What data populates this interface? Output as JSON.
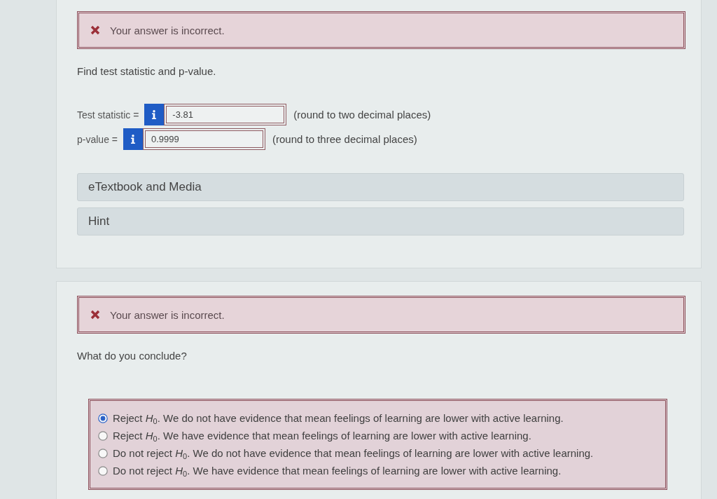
{
  "questions": [
    {
      "feedback": {
        "kind": "incorrect",
        "text": "Your answer is incorrect."
      },
      "prompt": "Find test statistic and p-value.",
      "fields": [
        {
          "label": "Test statistic =",
          "value": "-3.81",
          "note": "(round to two decimal places)"
        },
        {
          "label": "p-value =",
          "value": "0.9999",
          "note": "(round to three decimal places)"
        }
      ],
      "resources": [
        {
          "label": "eTextbook and Media"
        },
        {
          "label": "Hint"
        }
      ]
    },
    {
      "feedback": {
        "kind": "incorrect",
        "text": "Your answer is incorrect."
      },
      "prompt": "What do you conclude?",
      "options": [
        {
          "text": "Reject *H*$_{0}$. We do not have evidence that mean feelings of learning are lower with active learning.",
          "selected": true
        },
        {
          "text": "Reject *H*$_{0}$. We have evidence that mean feelings of learning are lower with active learning.",
          "selected": false
        },
        {
          "text": "Do not reject *H*$_{0}$. We do not have evidence that mean feelings of learning are lower with active learning.",
          "selected": false
        },
        {
          "text": "Do not reject *H*$_{0}$. We have evidence that mean feelings of learning are lower with active learning.",
          "selected": false
        }
      ]
    }
  ]
}
